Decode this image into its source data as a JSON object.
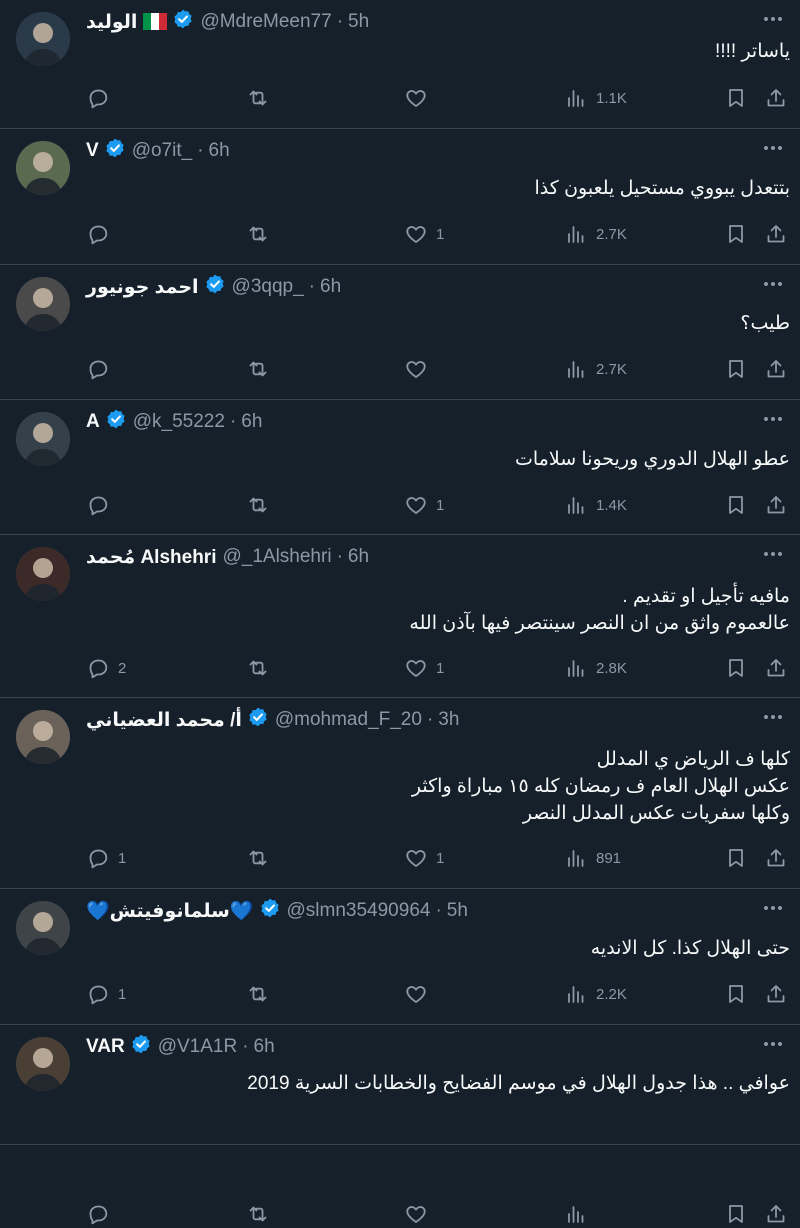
{
  "colors": {
    "background": "#15202b",
    "text": "#f7f9f9",
    "muted": "#8b98a5",
    "verified": "#1d9bf0",
    "divider": "#38444d"
  },
  "tweets": [
    {
      "name": "الوليد",
      "badges": [
        "italy-flag-icon",
        "verified-badge-icon"
      ],
      "handle": "@MdreMeen77",
      "dot": "·",
      "time": "5h",
      "text": "ياساتر !!!!",
      "replies": "",
      "retweets": "",
      "likes": "",
      "views": "1.1K"
    },
    {
      "name": "V",
      "badges": [
        "verified-badge-icon"
      ],
      "handle": "@o7it_",
      "dot": "·",
      "time": "6h",
      "text": "بتتعدل يبووي مستحيل يلعبون كذا",
      "replies": "",
      "retweets": "",
      "likes": "1",
      "views": "2.7K"
    },
    {
      "name": "احمد جونيور",
      "badges": [
        "verified-badge-icon"
      ],
      "handle": "@3qqp_",
      "dot": "·",
      "time": "6h",
      "text": "طيب؟",
      "replies": "",
      "retweets": "",
      "likes": "",
      "views": "2.7K"
    },
    {
      "name": "A",
      "badges": [
        "verified-badge-icon"
      ],
      "handle": "@k_55222",
      "dot": "·",
      "time": "6h",
      "text": "عطو الهلال الدوري وريحونا سلامات",
      "replies": "",
      "retweets": "",
      "likes": "1",
      "views": "1.4K"
    },
    {
      "name": "مُحمد Alshehri",
      "badges": [],
      "handle": "@_1Alshehri",
      "dot": "·",
      "time": "6h",
      "text": "مافيه تأجيل او تقديم .\nعالعموم واثق من ان النصر سينتصر فيها بآذن الله",
      "replies": "2",
      "retweets": "",
      "likes": "1",
      "views": "2.8K"
    },
    {
      "name": "أ/ محمد العضياني",
      "badges": [
        "verified-badge-icon"
      ],
      "handle": "@mohmad_F_20",
      "dot": "·",
      "time": "3h",
      "text": "كلها ف الرياض ي المدلل\nعكس الهلال العام ف رمضان كله ١٥ مباراة واكثر\nوكلها سفريات عكس المدلل النصر",
      "replies": "1",
      "retweets": "",
      "likes": "1",
      "views": "891"
    },
    {
      "name": "💙سلمانوفيتش💙",
      "badges": [
        "verified-badge-icon"
      ],
      "handle": "@slmn35490964",
      "dot": "·",
      "time": "5h",
      "text": "حتى الهلال كذا. كل الانديه",
      "replies": "1",
      "retweets": "",
      "likes": "",
      "views": "2.2K"
    },
    {
      "name": "VAR",
      "badges": [
        "verified-badge-icon"
      ],
      "handle": "@V1A1R",
      "dot": "·",
      "time": "6h",
      "text": "عوافي .. هذا جدول الهلال في موسم الفضايح والخطابات السرية 2019",
      "replies": "",
      "retweets": "",
      "likes": "",
      "views": ""
    }
  ]
}
